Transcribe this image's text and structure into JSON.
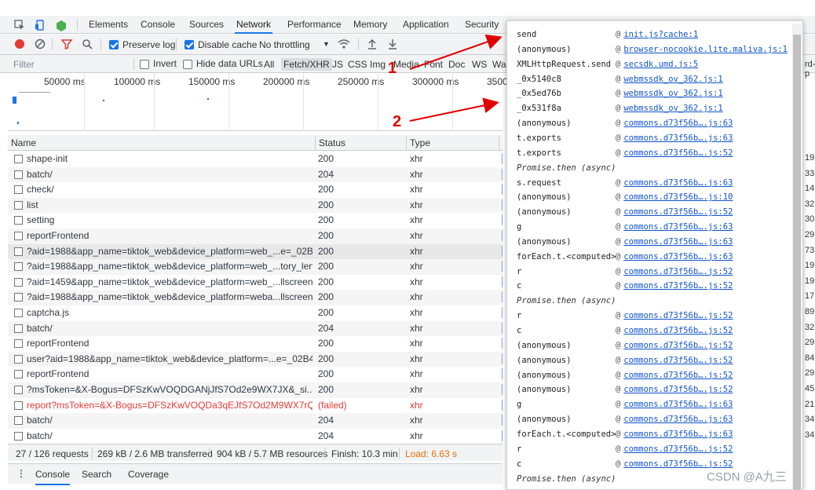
{
  "tabs": [
    {
      "label": "Elements",
      "active": false
    },
    {
      "label": "Console",
      "active": false
    },
    {
      "label": "Sources",
      "active": false
    },
    {
      "label": "Network",
      "active": true
    },
    {
      "label": "Performance",
      "active": false
    },
    {
      "label": "Memory",
      "active": false
    },
    {
      "label": "Application",
      "active": false
    },
    {
      "label": "Security",
      "active": false
    }
  ],
  "toolbar": {
    "preserve_log": "Preserve log",
    "disable_cache": "Disable cache",
    "throttling": "No throttling",
    "throttle_arrow": "▼"
  },
  "filter": {
    "placeholder": "Filter",
    "invert": "Invert",
    "hide_data_urls": "Hide data URLs",
    "types": [
      "All",
      "Fetch/XHR",
      "JS",
      "CSS",
      "Img",
      "Media",
      "Font",
      "Doc",
      "WS",
      "Was"
    ],
    "selected_type": "Fetch/XHR"
  },
  "overview": {
    "ticks": [
      "50000 ms",
      "100000 ms",
      "150000 ms",
      "200000 ms",
      "250000 ms",
      "300000 ms",
      "3500"
    ]
  },
  "table": {
    "headers": {
      "name": "Name",
      "status": "Status",
      "type": "Type",
      "initiator": "I"
    },
    "rows": [
      {
        "name": "shape-init",
        "status": "200",
        "type": "xhr",
        "right": "19"
      },
      {
        "name": "batch/",
        "status": "204",
        "type": "xhr",
        "right": "33"
      },
      {
        "name": "check/",
        "status": "200",
        "type": "xhr",
        "right": "14"
      },
      {
        "name": "list",
        "status": "200",
        "type": "xhr",
        "right": "32"
      },
      {
        "name": "setting",
        "status": "200",
        "type": "xhr",
        "right": "30"
      },
      {
        "name": "reportFrontend",
        "status": "200",
        "type": "xhr",
        "right": "29"
      },
      {
        "name": "?aid=1988&app_name=tiktok_web&device_platform=web_...e=_02B4Z...",
        "status": "200",
        "type": "xhr",
        "right": "73"
      },
      {
        "name": "?aid=1988&app_name=tiktok_web&device_platform=web_...tory_len=...",
        "status": "200",
        "type": "xhr",
        "right": "19"
      },
      {
        "name": "?aid=1459&app_name=tiktok_web&device_platform=web_...llscreen=f...",
        "status": "200",
        "type": "xhr",
        "right": "19"
      },
      {
        "name": "?aid=1988&app_name=tiktok_web&device_platform=weba...llscreen=f...",
        "status": "200",
        "type": "xhr",
        "right": "17"
      },
      {
        "name": "captcha.js",
        "status": "200",
        "type": "xhr",
        "right": "89"
      },
      {
        "name": "batch/",
        "status": "204",
        "type": "xhr",
        "right": "32"
      },
      {
        "name": "reportFrontend",
        "status": "200",
        "type": "xhr",
        "right": "29"
      },
      {
        "name": "user?aid=1988&app_name=tiktok_web&device_platform=...e=_02B4Z6...",
        "status": "200",
        "type": "xhr",
        "right": "84"
      },
      {
        "name": "reportFrontend",
        "status": "200",
        "type": "xhr",
        "right": "29"
      },
      {
        "name": "?msToken=&X-Bogus=DFSzKwVOQDGANjJfS7Od2e9WX7JX&_si...e=_0...",
        "status": "200",
        "type": "xhr",
        "right": "45"
      },
      {
        "name": "report?msToken=&X-Bogus=DFSzKwVOQDa3qEJfS7Od2M9WX7rQ",
        "status": "(failed)",
        "type": "xhr",
        "right": "21",
        "failed": true
      },
      {
        "name": "batch/",
        "status": "204",
        "type": "xhr",
        "right": "34"
      },
      {
        "name": "batch/",
        "status": "204",
        "type": "xhr",
        "right": "34"
      }
    ]
  },
  "statusbar": {
    "requests": "27 / 126 requests",
    "transferred": "269 kB / 2.6 MB transferred",
    "resources": "904 kB / 5.7 MB resources",
    "finish": "Finish: 10.3 min",
    "load": "Load: 6.63 s"
  },
  "drawer": {
    "tabs": [
      "Console",
      "Search",
      "Coverage"
    ]
  },
  "popup": {
    "lines": [
      {
        "fn": "send",
        "src": "init.js?cache:1"
      },
      {
        "fn": "(anonymous)",
        "src": "browser-nocookie.lite.maliva.js:1"
      },
      {
        "fn": "XMLHttpRequest.send",
        "src": "secsdk.umd.js:5"
      },
      {
        "fn": "_0x5140c8",
        "src": "webmssdk_ov_362.js:1"
      },
      {
        "fn": "_0x5ed76b",
        "src": "webmssdk_ov_362.js:1"
      },
      {
        "fn": "_0x531f8a",
        "src": "webmssdk_ov_362.js:1"
      },
      {
        "fn": "(anonymous)",
        "src": "commons.d73f56b….js:63"
      },
      {
        "fn": "t.exports",
        "src": "commons.d73f56b….js:63"
      },
      {
        "fn": "t.exports",
        "src": "commons.d73f56b….js:52"
      },
      {
        "async": "Promise.then (async)"
      },
      {
        "fn": "s.request",
        "src": "commons.d73f56b….js:63"
      },
      {
        "fn": "(anonymous)",
        "src": "commons.d73f56b….js:10"
      },
      {
        "fn": "(anonymous)",
        "src": "commons.d73f56b….js:52"
      },
      {
        "fn": "g",
        "src": "commons.d73f56b….js:63"
      },
      {
        "fn": "(anonymous)",
        "src": "commons.d73f56b….js:63"
      },
      {
        "fn": "forEach.t.<computed>",
        "src": "commons.d73f56b….js:63"
      },
      {
        "fn": "r",
        "src": "commons.d73f56b….js:52"
      },
      {
        "fn": "c",
        "src": "commons.d73f56b….js:52"
      },
      {
        "async": "Promise.then (async)"
      },
      {
        "fn": "r",
        "src": "commons.d73f56b….js:52"
      },
      {
        "fn": "c",
        "src": "commons.d73f56b….js:52"
      },
      {
        "fn": "(anonymous)",
        "src": "commons.d73f56b….js:52"
      },
      {
        "fn": "(anonymous)",
        "src": "commons.d73f56b….js:52"
      },
      {
        "fn": "(anonymous)",
        "src": "commons.d73f56b….js:52"
      },
      {
        "fn": "(anonymous)",
        "src": "commons.d73f56b….js:52"
      },
      {
        "fn": "g",
        "src": "commons.d73f56b….js:63"
      },
      {
        "fn": "(anonymous)",
        "src": "commons.d73f56b….js:63"
      },
      {
        "fn": "forEach.t.<computed>",
        "src": "commons.d73f56b….js:63"
      },
      {
        "fn": "r",
        "src": "commons.d73f56b….js:52"
      },
      {
        "fn": "c",
        "src": "commons.d73f56b….js:52"
      },
      {
        "async": "Promise.then (async)"
      }
    ],
    "at": "@"
  },
  "annotations": {
    "one": "1",
    "two": "2"
  },
  "watermark": "CSDN @A九三",
  "rightcol_top": "rd-p"
}
